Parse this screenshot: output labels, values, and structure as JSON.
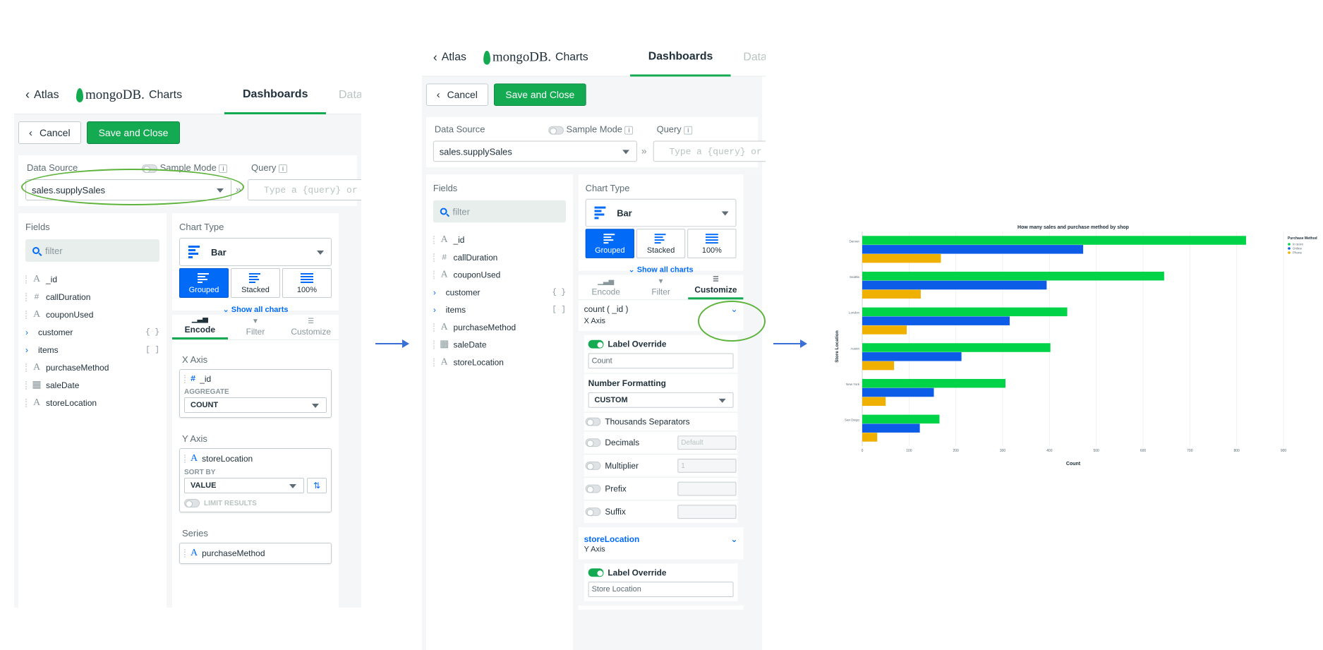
{
  "header": {
    "back_label": "Atlas",
    "logo_text": "mongoDB.",
    "logo_product": "Charts",
    "tab_dashboards": "Dashboards",
    "tab_data": "Data"
  },
  "actions": {
    "cancel": "Cancel",
    "save": "Save and Close"
  },
  "datasource": {
    "label": "Data Source",
    "value": "sales.supplySales",
    "sample_mode": "Sample Mode",
    "info": "i",
    "query_label": "Query",
    "query_placeholder": "Type a {query} or",
    "chevrons": "»"
  },
  "fields": {
    "title": "Fields",
    "filter_placeholder": "filter",
    "items": [
      {
        "name": "_id",
        "icon": "A"
      },
      {
        "name": "callDuration",
        "icon": "#"
      },
      {
        "name": "couponUsed",
        "icon": "A"
      },
      {
        "name": "customer",
        "icon": "{ }"
      },
      {
        "name": "items",
        "icon": "[ ]"
      },
      {
        "name": "purchaseMethod",
        "icon": "A"
      },
      {
        "name": "saleDate",
        "icon": "calendar"
      },
      {
        "name": "storeLocation",
        "icon": "A"
      }
    ]
  },
  "chart_type": {
    "label": "Chart Type",
    "value": "Bar",
    "grouped": "Grouped",
    "stacked": "Stacked",
    "percent": "100%",
    "show_all": "Show all charts"
  },
  "tabs": {
    "encode": "Encode",
    "filter": "Filter",
    "customize": "Customize"
  },
  "encode": {
    "x_axis": "X Axis",
    "x_field": "_id",
    "aggregate": "AGGREGATE",
    "aggregate_value": "COUNT",
    "y_axis": "Y Axis",
    "y_field": "storeLocation",
    "sort_by": "SORT BY",
    "sort_value": "VALUE",
    "limit_results": "LIMIT RESULTS",
    "series": "Series",
    "series_field": "purchaseMethod"
  },
  "customize": {
    "count_field": "count ( _id )",
    "x_axis": "X Axis",
    "label_override": "Label Override",
    "x_label_value": "Count",
    "number_formatting": "Number Formatting",
    "number_format_value": "CUSTOM",
    "thousands": "Thousands Separators",
    "decimals": "Decimals",
    "decimals_placeholder": "Default",
    "multiplier": "Multiplier",
    "multiplier_value": "1",
    "prefix": "Prefix",
    "suffix": "Suffix",
    "y_field": "storeLocation",
    "y_axis": "Y Axis",
    "y_label_value": "Store Location"
  },
  "colors": {
    "green": "#00d348",
    "blue": "#0d5ce8",
    "yellow": "#f0b000",
    "mongo_green": "#13aa52",
    "link_blue": "#016bf8"
  },
  "chart_data": {
    "type": "bar",
    "orientation": "horizontal",
    "title": "How many sales and purchase method by shop",
    "xlabel": "Count",
    "ylabel": "Store Location",
    "categories": [
      "Denver",
      "Seattle",
      "London",
      "Austin",
      "New York",
      "San Diego"
    ],
    "series": [
      {
        "name": "In store",
        "color": "#00d348",
        "values": [
          820,
          645,
          438,
          402,
          306,
          165
        ]
      },
      {
        "name": "Online",
        "color": "#0d5ce8",
        "values": [
          472,
          394,
          315,
          212,
          153,
          123
        ]
      },
      {
        "name": "Phone",
        "color": "#f0b000",
        "values": [
          168,
          125,
          95,
          68,
          50,
          32
        ]
      }
    ],
    "xlim": [
      0,
      900
    ],
    "xticks": [
      0,
      100,
      200,
      300,
      400,
      500,
      600,
      700,
      800,
      900
    ],
    "legend_title": "Purchase Method",
    "legend_position": "top-right",
    "grid": true
  }
}
